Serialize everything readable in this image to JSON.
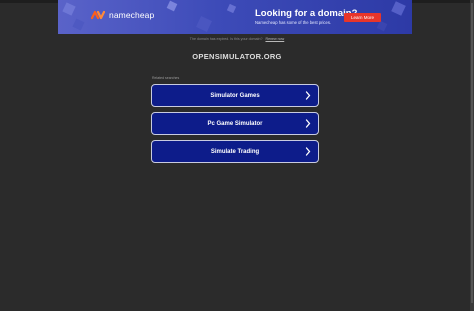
{
  "ad": {
    "brand": "namecheap",
    "title": "Looking for a domain?",
    "subtitle": "Namecheap has some of the best prices.",
    "cta": "Learn More",
    "colors": {
      "brand_orange": "#ff5e1a",
      "cta_red": "#e8352a",
      "banner_blue": "#3d4bb8"
    }
  },
  "notice": {
    "text": "The domain has expired. Is this your domain?",
    "link": "Renew now"
  },
  "domain": "OPENSIMULATOR.ORG",
  "related": {
    "label": "Related searches",
    "items": [
      {
        "label": "Simulator Games",
        "icon": "chevron-right-icon"
      },
      {
        "label": "Pc Game Simulator",
        "icon": "chevron-right-icon"
      },
      {
        "label": "Simulate Trading",
        "icon": "chevron-right-icon"
      }
    ]
  },
  "colors": {
    "background": "#2b2b2b",
    "button_bg": "#0d1c8a",
    "button_border": "#c8cbe0"
  }
}
